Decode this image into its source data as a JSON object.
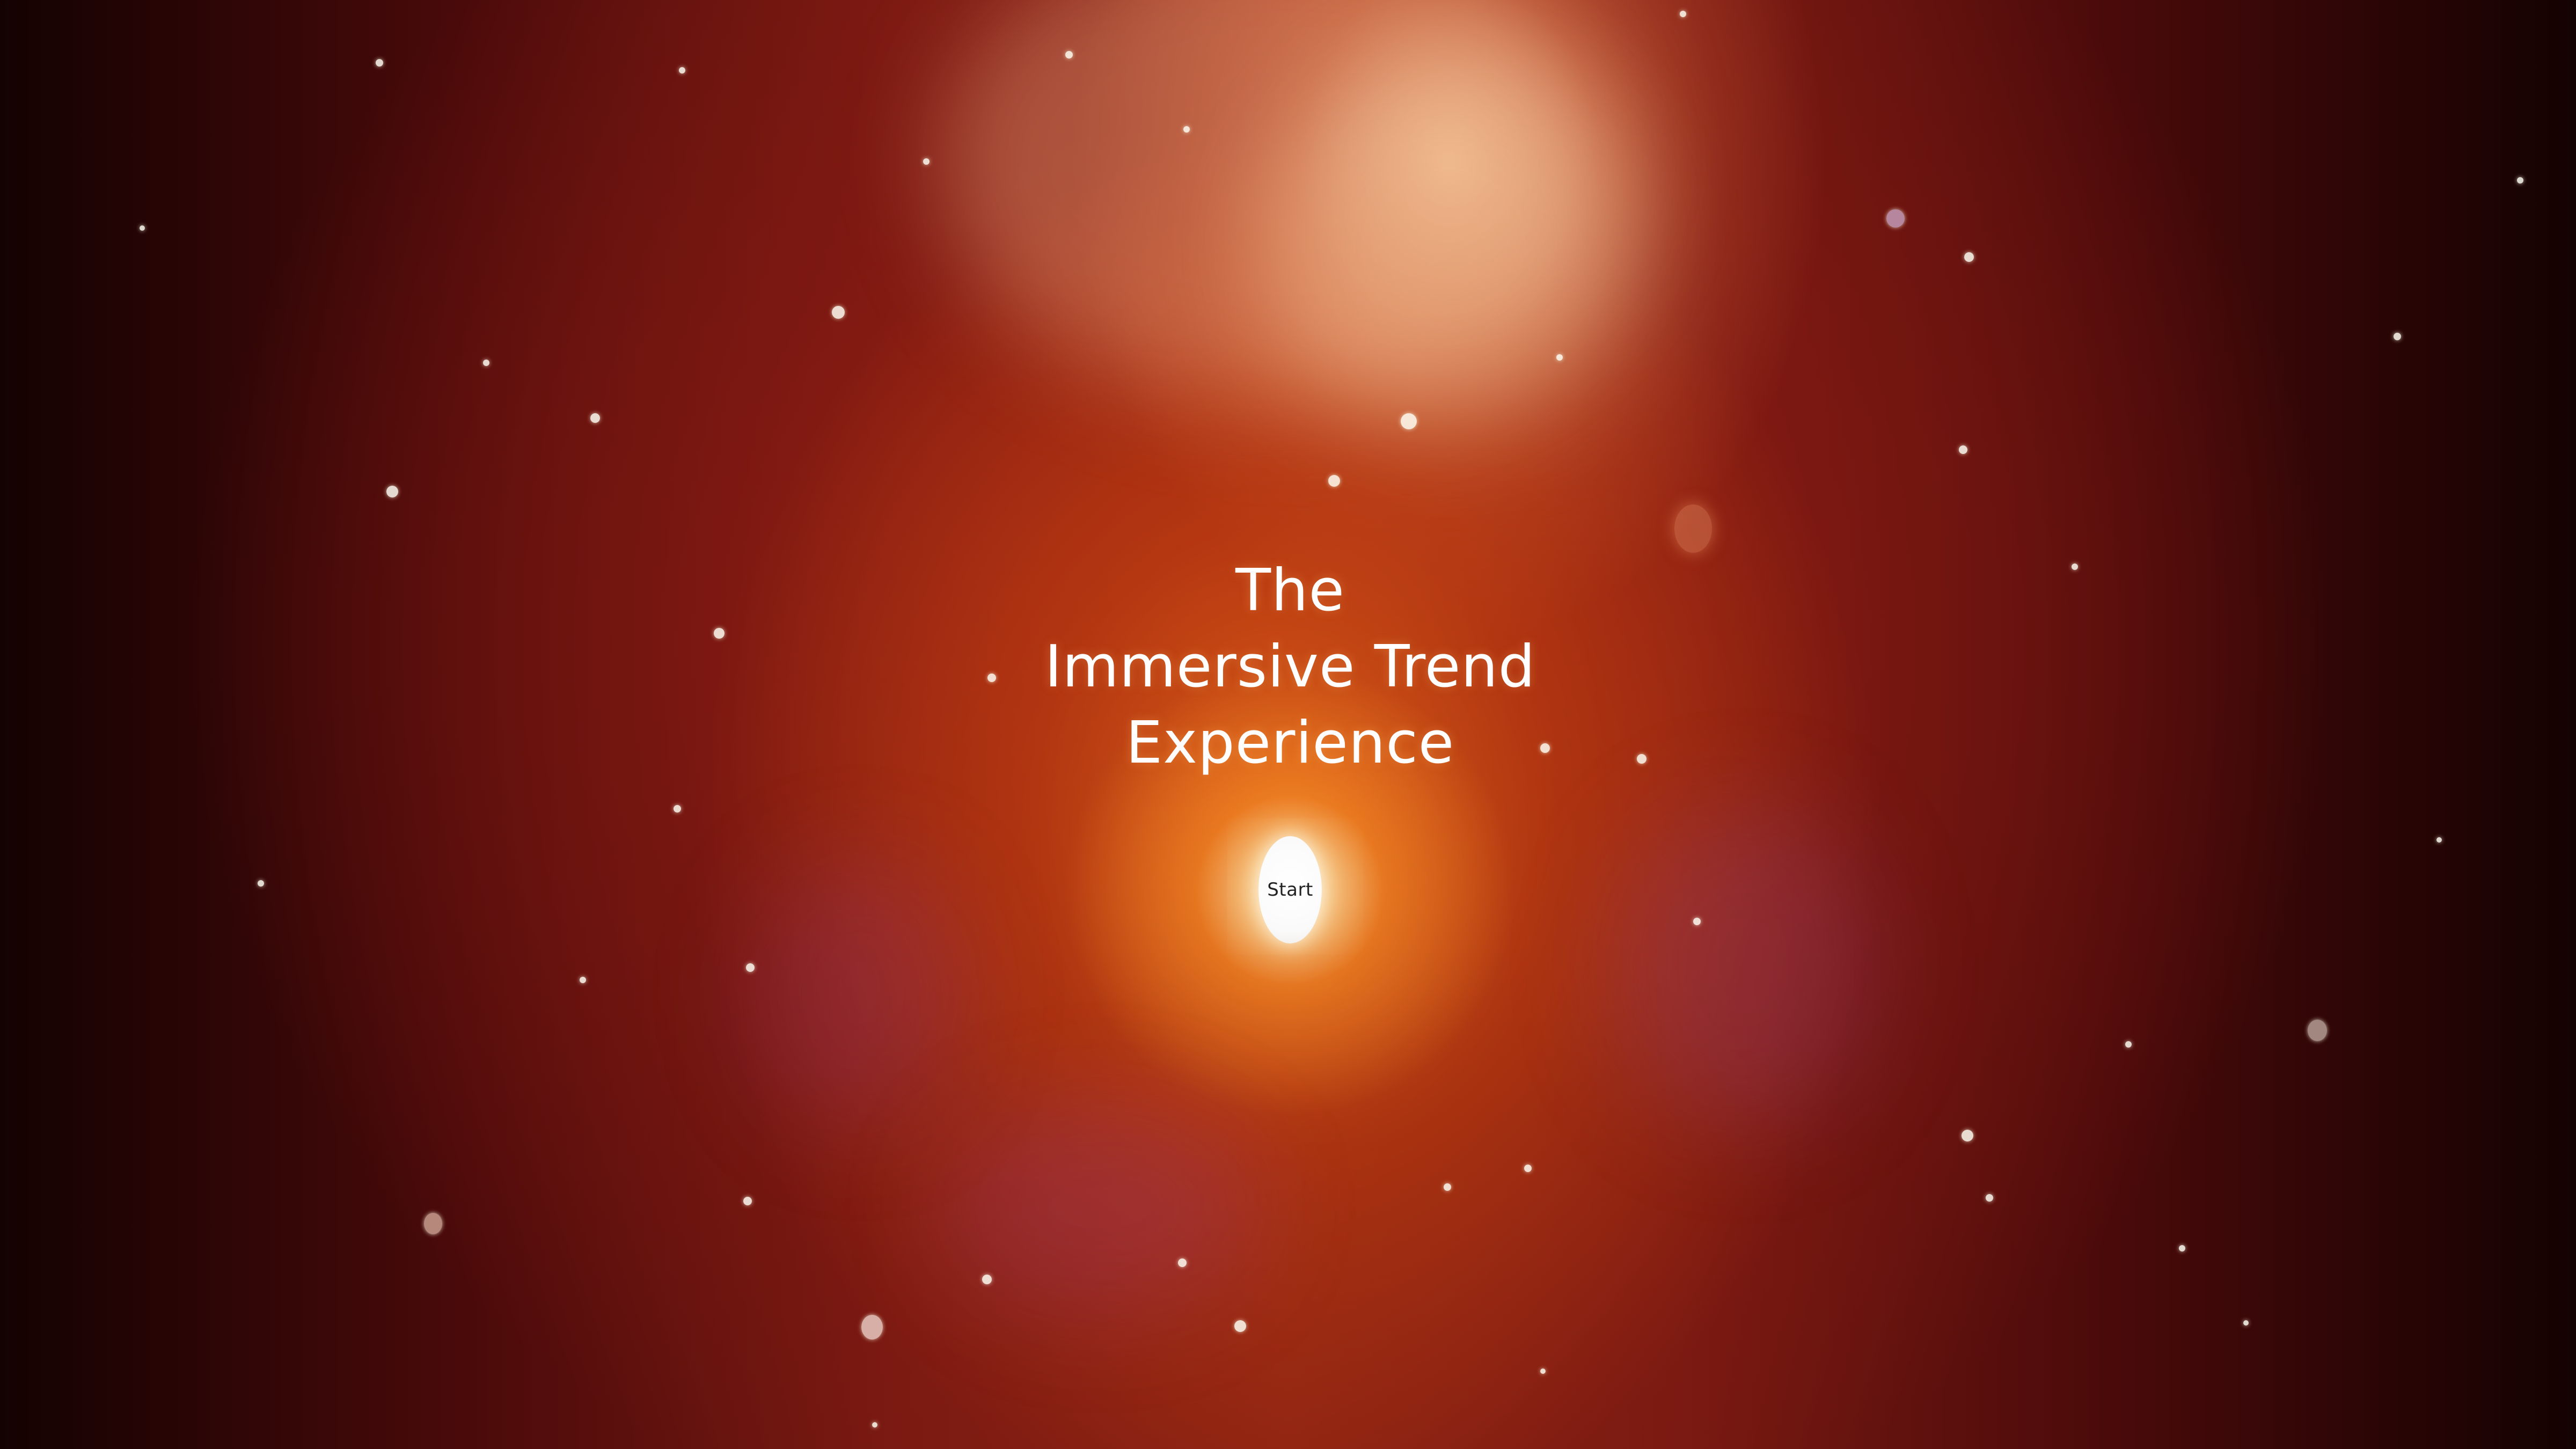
{
  "intro": {
    "title": "The\nImmersive Trend\nExperience",
    "start_label": "Start"
  },
  "theme": {
    "background": "#8e2414",
    "glow": "#ff9a3c",
    "button_bg": "#ffffff",
    "button_text": "#222222",
    "title_text": "#ffffff"
  }
}
